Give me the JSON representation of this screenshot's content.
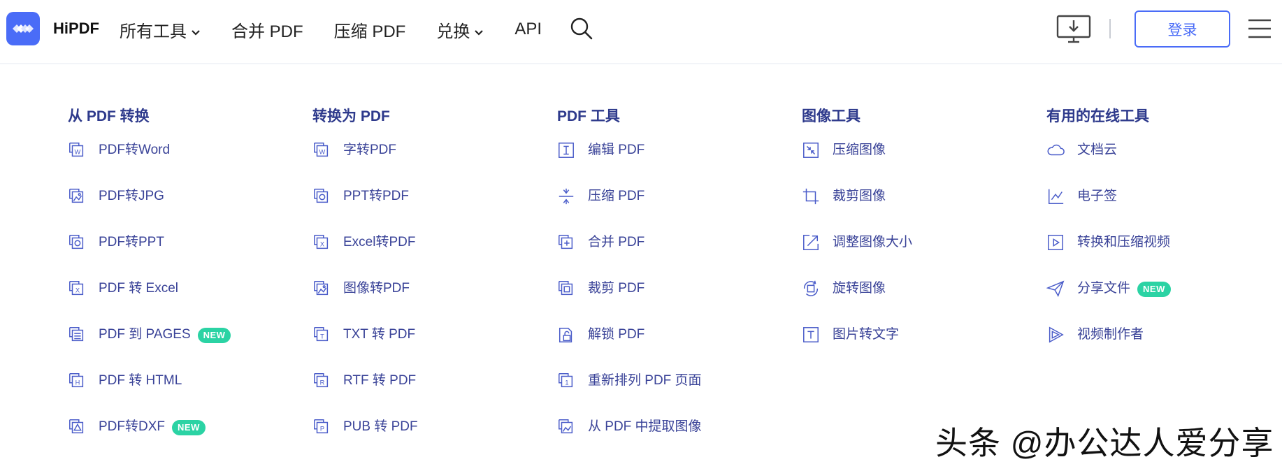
{
  "header": {
    "brand": "HiPDF",
    "nav": [
      {
        "label": "所有工具",
        "dropdown": true
      },
      {
        "label": "合并 PDF",
        "dropdown": false
      },
      {
        "label": "压缩 PDF",
        "dropdown": false
      },
      {
        "label": "兑换",
        "dropdown": true
      },
      {
        "label": "API",
        "dropdown": false
      }
    ],
    "login_label": "登录",
    "accent_color": "#4a6cf7"
  },
  "menu": {
    "columns": [
      {
        "title": "从 PDF 转换",
        "items": [
          {
            "label": "PDF转Word",
            "icon": "word-doc-icon",
            "badge": ""
          },
          {
            "label": "PDF转JPG",
            "icon": "image-doc-icon",
            "badge": ""
          },
          {
            "label": "PDF转PPT",
            "icon": "ppt-doc-icon",
            "badge": ""
          },
          {
            "label": "PDF 转 Excel",
            "icon": "excel-doc-icon",
            "badge": ""
          },
          {
            "label": "PDF 到 PAGES",
            "icon": "pages-doc-icon",
            "badge": "NEW"
          },
          {
            "label": "PDF 转 HTML",
            "icon": "html-doc-icon",
            "badge": ""
          },
          {
            "label": "PDF转DXF",
            "icon": "dxf-doc-icon",
            "badge": "NEW"
          }
        ]
      },
      {
        "title": "转换为 PDF",
        "items": [
          {
            "label": "字转PDF",
            "icon": "word-doc-icon",
            "badge": ""
          },
          {
            "label": "PPT转PDF",
            "icon": "ppt-doc-icon",
            "badge": ""
          },
          {
            "label": "Excel转PDF",
            "icon": "excel-doc-icon",
            "badge": ""
          },
          {
            "label": "图像转PDF",
            "icon": "image-doc-icon",
            "badge": ""
          },
          {
            "label": "TXT 转 PDF",
            "icon": "txt-doc-icon",
            "badge": ""
          },
          {
            "label": "RTF 转 PDF",
            "icon": "rtf-doc-icon",
            "badge": ""
          },
          {
            "label": "PUB 转 PDF",
            "icon": "pub-doc-icon",
            "badge": ""
          }
        ]
      },
      {
        "title": "PDF 工具",
        "items": [
          {
            "label": "编辑 PDF",
            "icon": "edit-text-icon",
            "badge": ""
          },
          {
            "label": "压缩 PDF",
            "icon": "compress-icon",
            "badge": ""
          },
          {
            "label": "合并 PDF",
            "icon": "merge-icon",
            "badge": ""
          },
          {
            "label": "裁剪 PDF",
            "icon": "crop-doc-icon",
            "badge": ""
          },
          {
            "label": "解锁 PDF",
            "icon": "unlock-icon",
            "badge": ""
          },
          {
            "label": "重新排列 PDF 页面",
            "icon": "reorder-icon",
            "badge": ""
          },
          {
            "label": "从 PDF 中提取图像",
            "icon": "extract-image-icon",
            "badge": ""
          }
        ]
      },
      {
        "title": "图像工具",
        "items": [
          {
            "label": "压缩图像",
            "icon": "compress-image-icon",
            "badge": ""
          },
          {
            "label": "裁剪图像",
            "icon": "crop-icon",
            "badge": ""
          },
          {
            "label": "调整图像大小",
            "icon": "resize-icon",
            "badge": ""
          },
          {
            "label": "旋转图像",
            "icon": "rotate-icon",
            "badge": ""
          },
          {
            "label": "图片转文字",
            "icon": "ocr-text-icon",
            "badge": ""
          }
        ]
      },
      {
        "title": "有用的在线工具",
        "items": [
          {
            "label": "文档云",
            "icon": "cloud-icon",
            "badge": ""
          },
          {
            "label": "电子签",
            "icon": "signature-icon",
            "badge": ""
          },
          {
            "label": "转换和压缩视频",
            "icon": "video-play-icon",
            "badge": ""
          },
          {
            "label": "分享文件",
            "icon": "send-icon",
            "badge": "NEW"
          },
          {
            "label": "视频制作者",
            "icon": "play-triangle-icon",
            "badge": ""
          }
        ]
      }
    ],
    "title_color": "#2e3a8c",
    "item_color": "#3a4398",
    "icon_color": "#4a5cc9",
    "badge_color": "#2bd3a4"
  },
  "watermark": "头条 @办公达人爱分享"
}
